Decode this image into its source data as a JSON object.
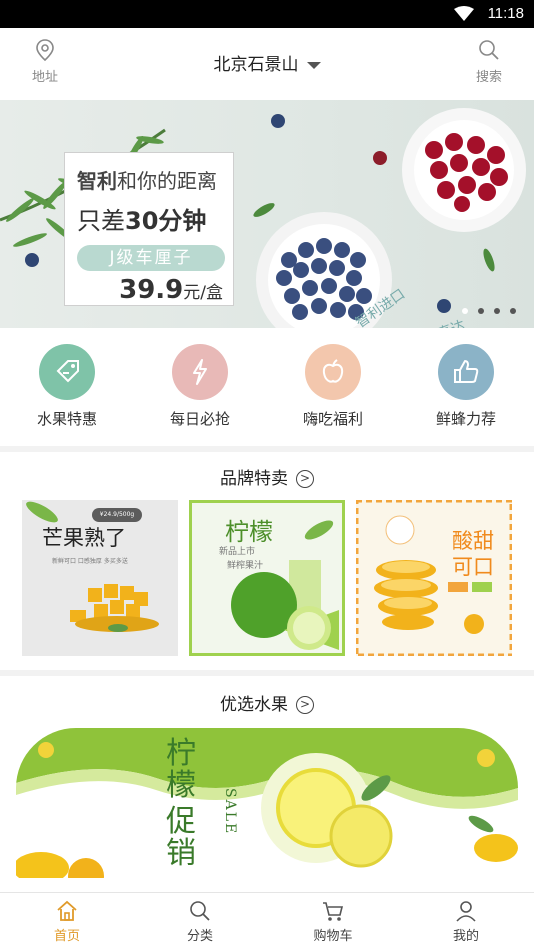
{
  "status": {
    "time": "11:18"
  },
  "header": {
    "address_label": "地址",
    "location": "北京石景山",
    "search_label": "搜索"
  },
  "banner": {
    "line1_bold": "智利",
    "line1_rest": "和你的距离",
    "line2_pre": "只差",
    "line2_bold": "30分钟",
    "pill": "J级车厘子",
    "price": "39.9",
    "price_unit": "元/盒",
    "stamp1": "智利进口",
    "stamp2": "新鲜直达",
    "slide_count": 4,
    "active_slide": 0
  },
  "quick_entries": [
    {
      "label": "水果特惠",
      "icon": "tag-icon",
      "color": "#7fc3a8"
    },
    {
      "label": "每日必抢",
      "icon": "lightning-icon",
      "color": "#e8b9b7"
    },
    {
      "label": "嗨吃福利",
      "icon": "apple-icon",
      "color": "#f3c7ad"
    },
    {
      "label": "鲜蜂力荐",
      "icon": "thumbs-up-icon",
      "color": "#8bb3c7"
    }
  ],
  "brand_section": {
    "title": "品牌特卖",
    "products": [
      {
        "title": "芒果熟了",
        "tag": "¥24.9/500g",
        "sub": "新鲜可口 口感独厚 多买多送"
      },
      {
        "title": "柠檬",
        "sub": "新品上市",
        "sub2": "鲜榨果汁"
      },
      {
        "title": "酸甜可口"
      }
    ]
  },
  "select_section": {
    "title": "优选水果",
    "banner_title1": "柠檬",
    "banner_title2": "促销",
    "banner_en": "SALE"
  },
  "tabbar": [
    {
      "label": "首页",
      "icon": "home-icon",
      "active": true
    },
    {
      "label": "分类",
      "icon": "search-icon",
      "active": false
    },
    {
      "label": "购物车",
      "icon": "cart-icon",
      "active": false
    },
    {
      "label": "我的",
      "icon": "user-icon",
      "active": false
    }
  ],
  "colors": {
    "accent": "#e09a2a",
    "banner_bg": "#e1e8e4"
  }
}
